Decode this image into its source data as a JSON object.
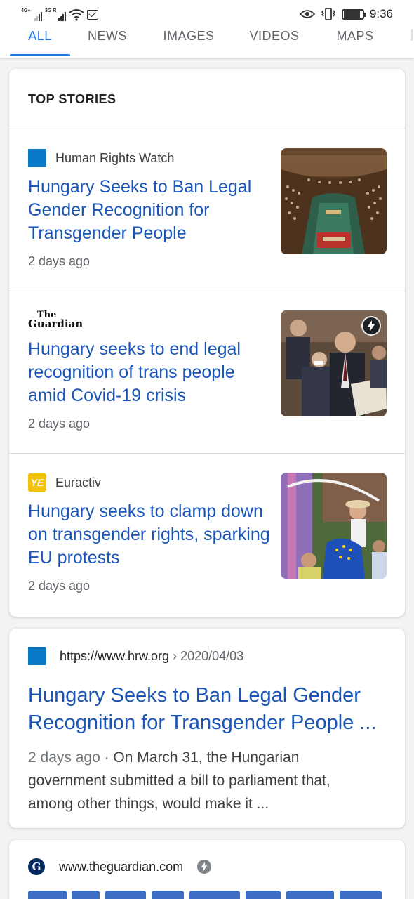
{
  "status_bar": {
    "network_1": "4G+",
    "network_2": "3G R",
    "time": "9:36",
    "battery_level": 0.9,
    "icons": [
      "signal-icon",
      "wifi-icon",
      "message-icon",
      "eye-icon",
      "vibrate-icon",
      "battery-icon"
    ]
  },
  "tabs": [
    {
      "label": "ALL",
      "active": true
    },
    {
      "label": "NEWS",
      "active": false
    },
    {
      "label": "IMAGES",
      "active": false
    },
    {
      "label": "VIDEOS",
      "active": false
    },
    {
      "label": "MAPS",
      "active": false
    }
  ],
  "top_stories": {
    "heading": "TOP STORIES",
    "stories": [
      {
        "source": "Human Rights Watch",
        "headline": "Hungary Seeks to Ban Legal Gender Recognition for Transgender People",
        "age": "2 days ago",
        "thumbnail": "parliament-chamber-image",
        "amp": false
      },
      {
        "source_logo_line1": "The",
        "source_logo_line2": "Guardian",
        "headline": "Hungary seeks to end legal recognition of trans people amid Covid-19 crisis",
        "age": "2 days ago",
        "thumbnail": "parliament-speaker-image",
        "amp": true
      },
      {
        "source": "Euractiv",
        "source_logo_text": "YE",
        "headline": "Hungary seeks to clamp down on transgender rights, sparking EU protests",
        "age": "2 days ago",
        "thumbnail": "protest-crowd-image",
        "amp": false
      }
    ]
  },
  "result_hrw": {
    "url": "https://www.hrw.org",
    "path": "› 2020/04/03",
    "title": "Hungary Seeks to Ban Legal Gender Recognition for Transgender People ...",
    "date": "2 days ago",
    "separator": " · ",
    "snippet": "On March 31, the Hungarian government submitted a bill to parliament that, among other things, would make it ..."
  },
  "result_guardian": {
    "url": "www.theguardian.com"
  },
  "colors": {
    "link": "#1a56b8",
    "accent": "#1a73e8",
    "hrw_favicon": "#0779c6",
    "euractiv_favicon": "#f4c20d",
    "guardian_favicon": "#052962"
  }
}
